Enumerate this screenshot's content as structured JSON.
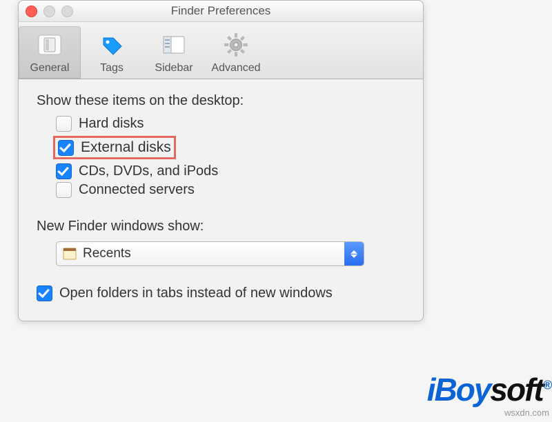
{
  "window": {
    "title": "Finder Preferences"
  },
  "toolbar": {
    "items": [
      {
        "id": "general",
        "label": "General",
        "selected": true
      },
      {
        "id": "tags",
        "label": "Tags",
        "selected": false
      },
      {
        "id": "sidebar",
        "label": "Sidebar",
        "selected": false
      },
      {
        "id": "advanced",
        "label": "Advanced",
        "selected": false
      }
    ]
  },
  "general": {
    "desktop_items_title": "Show these items on the desktop:",
    "items": [
      {
        "id": "hard-disks",
        "label": "Hard disks",
        "checked": false,
        "highlighted": false
      },
      {
        "id": "external-disks",
        "label": "External disks",
        "checked": true,
        "highlighted": true
      },
      {
        "id": "cds",
        "label": "CDs, DVDs, and iPods",
        "checked": true,
        "highlighted": false
      },
      {
        "id": "servers",
        "label": "Connected servers",
        "checked": false,
        "highlighted": false
      }
    ],
    "new_finder_title": "New Finder windows show:",
    "new_finder_value": "Recents",
    "open_in_tabs": {
      "label": "Open folders in tabs instead of new windows",
      "checked": true
    }
  },
  "watermark": {
    "brand": "iBoysoft",
    "site": "wsxdn.com"
  },
  "colors": {
    "accent": "#1a84ff",
    "highlight_border": "#e46a5f"
  }
}
